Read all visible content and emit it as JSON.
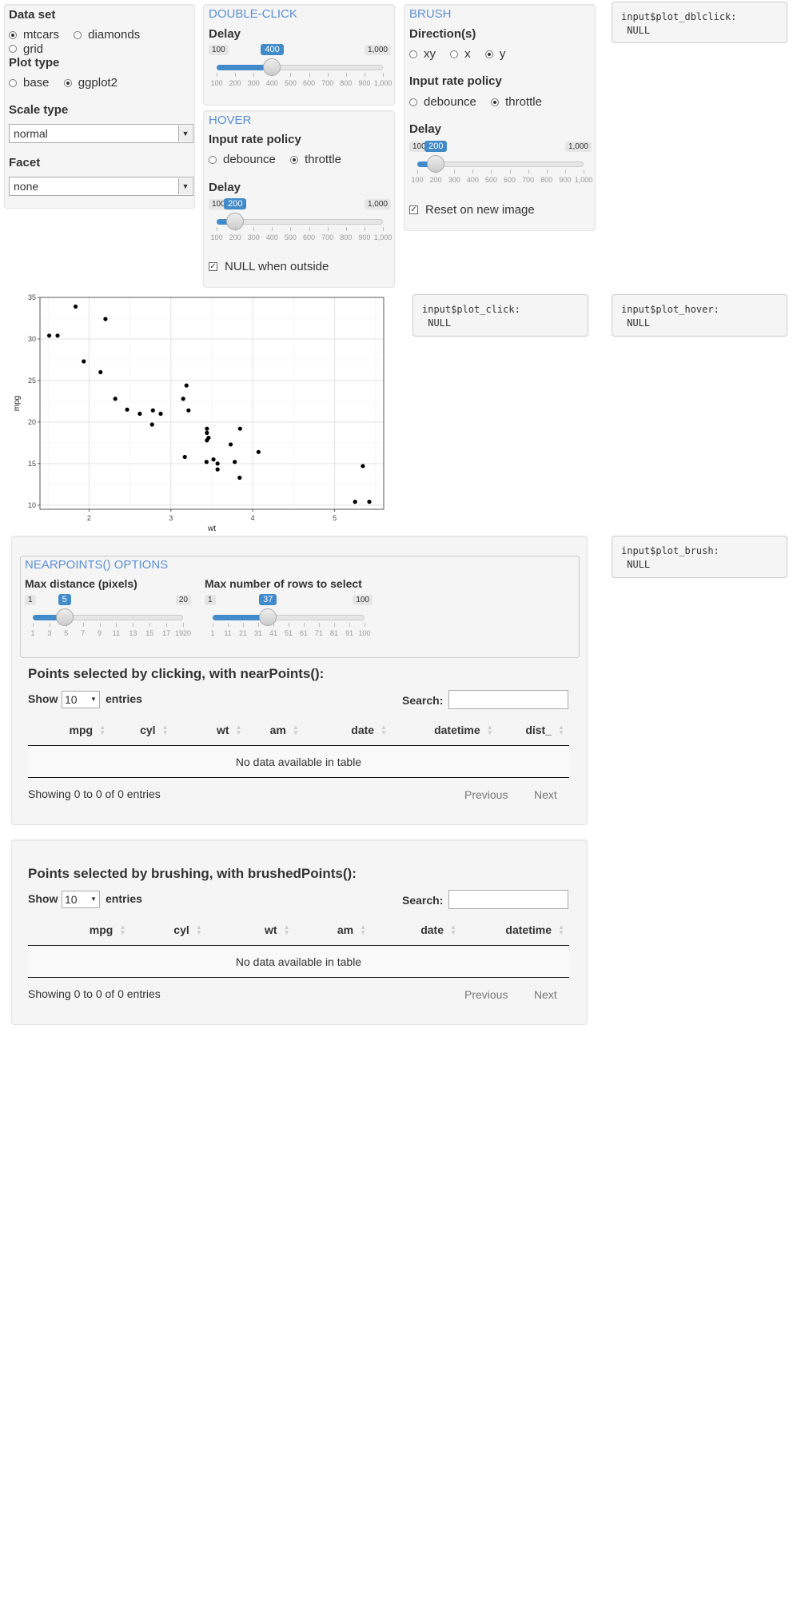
{
  "data_panel": {
    "dataset_label": "Data set",
    "dataset_options": [
      "mtcars",
      "diamonds",
      "grid"
    ],
    "dataset_selected": "mtcars",
    "plot_type_label": "Plot type",
    "plot_type_options": [
      "base",
      "ggplot2"
    ],
    "plot_type_selected": "ggplot2",
    "scale_type_label": "Scale type",
    "scale_type_value": "normal",
    "facet_label": "Facet",
    "facet_value": "none"
  },
  "dblclick_panel": {
    "title": "DOUBLE-CLICK",
    "delay_label": "Delay",
    "slider": {
      "min_label": "100",
      "max_label": "1,000",
      "value": 400,
      "min": 100,
      "max": 1000,
      "ticks": [
        "100",
        "200",
        "300",
        "400",
        "500",
        "600",
        "700",
        "800",
        "900",
        "1,000"
      ]
    }
  },
  "hover_panel": {
    "title": "HOVER",
    "policy_label": "Input rate policy",
    "policy_options": [
      "debounce",
      "throttle"
    ],
    "policy_selected": "throttle",
    "delay_label": "Delay",
    "slider": {
      "min_label": "100",
      "max_label": "1,000",
      "value": 200,
      "min": 100,
      "max": 1000,
      "ticks": [
        "100",
        "200",
        "300",
        "400",
        "500",
        "600",
        "700",
        "800",
        "900",
        "1,000"
      ]
    },
    "null_outside_label": "NULL when outside",
    "null_outside_checked": true
  },
  "brush_panel": {
    "title": "BRUSH",
    "direction_label": "Direction(s)",
    "direction_options": [
      "xy",
      "x",
      "y"
    ],
    "direction_selected": "y",
    "policy_label": "Input rate policy",
    "policy_options": [
      "debounce",
      "throttle"
    ],
    "policy_selected": "throttle",
    "delay_label": "Delay",
    "slider": {
      "min_label": "100",
      "max_label": "1,000",
      "value": 200,
      "min": 100,
      "max": 1000,
      "ticks": [
        "100",
        "200",
        "300",
        "400",
        "500",
        "600",
        "700",
        "800",
        "900",
        "1,000"
      ]
    },
    "reset_label": "Reset on new image",
    "reset_checked": true
  },
  "outputs": {
    "dblclick": "input$plot_dblclick:\n NULL",
    "click": "input$plot_click:\n NULL",
    "hover": "input$plot_hover:\n NULL",
    "brush": "input$plot_brush:\n NULL"
  },
  "chart_data": {
    "type": "scatter",
    "xlabel": "wt",
    "ylabel": "mpg",
    "xlim": [
      1.4,
      5.6
    ],
    "ylim": [
      9.5,
      35
    ],
    "x_ticks": [
      2,
      3,
      4,
      5
    ],
    "y_ticks": [
      10,
      15,
      20,
      25,
      30,
      35
    ],
    "grid": true,
    "x": [
      2.62,
      2.875,
      2.32,
      3.215,
      3.44,
      3.46,
      3.57,
      3.19,
      3.15,
      3.44,
      3.44,
      4.07,
      3.73,
      3.78,
      5.25,
      5.424,
      5.345,
      2.2,
      1.615,
      1.835,
      2.465,
      3.52,
      3.435,
      3.84,
      3.845,
      1.935,
      2.14,
      1.513,
      3.17,
      2.77,
      3.57,
      2.78
    ],
    "y": [
      21,
      21,
      22.8,
      21.4,
      18.7,
      18.1,
      14.3,
      24.4,
      22.8,
      19.2,
      17.8,
      16.4,
      17.3,
      15.2,
      10.4,
      10.4,
      14.7,
      32.4,
      30.4,
      33.9,
      21.5,
      15.5,
      15.2,
      13.3,
      19.2,
      27.3,
      26,
      30.4,
      15.8,
      19.7,
      15,
      21.4
    ]
  },
  "nearpoints": {
    "options_title": "NEARPOINTS() OPTIONS",
    "maxdist_label": "Max distance (pixels)",
    "maxdist_slider": {
      "min_label": "1",
      "max_label": "20",
      "value": 5,
      "min": 1,
      "max": 20,
      "ticks": [
        "1",
        "3",
        "5",
        "7",
        "9",
        "11",
        "13",
        "15",
        "17",
        "1920"
      ]
    },
    "maxrows_label": "Max number of rows to select",
    "maxrows_slider": {
      "min_label": "1",
      "max_label": "100",
      "value": 37,
      "min": 1,
      "max": 100,
      "ticks": [
        "1",
        "11",
        "21",
        "31",
        "41",
        "51",
        "61",
        "71",
        "81",
        "91",
        "100"
      ]
    },
    "heading": "Points selected by clicking, with nearPoints():",
    "show_label": "Show",
    "entries_value": "10",
    "entries_label": "entries",
    "search_label": "Search:",
    "columns": [
      "mpg",
      "cyl",
      "wt",
      "am",
      "date",
      "datetime",
      "dist_"
    ],
    "empty_text": "No data available in table",
    "info": "Showing 0 to 0 of 0 entries",
    "prev": "Previous",
    "next": "Next"
  },
  "brushed": {
    "heading": "Points selected by brushing, with brushedPoints():",
    "show_label": "Show",
    "entries_value": "10",
    "entries_label": "entries",
    "search_label": "Search:",
    "columns": [
      "mpg",
      "cyl",
      "wt",
      "am",
      "date",
      "datetime"
    ],
    "empty_text": "No data available in table",
    "info": "Showing 0 to 0 of 0 entries",
    "prev": "Previous",
    "next": "Next"
  }
}
